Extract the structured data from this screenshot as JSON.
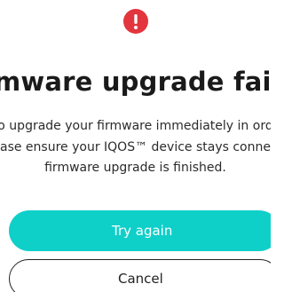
{
  "dialog": {
    "icon": "alert-icon",
    "icon_color": "#e2353d",
    "title": "Firmware upgrade failed",
    "message_lines": [
      "o upgrade your firmware immediately in ord",
      "ase ensure your IQOS™ device stays conne",
      "firmware upgrade is finished."
    ],
    "primary_button_label": "Try again",
    "primary_button_color": "#0fcfc9",
    "secondary_button_label": "Cancel"
  }
}
